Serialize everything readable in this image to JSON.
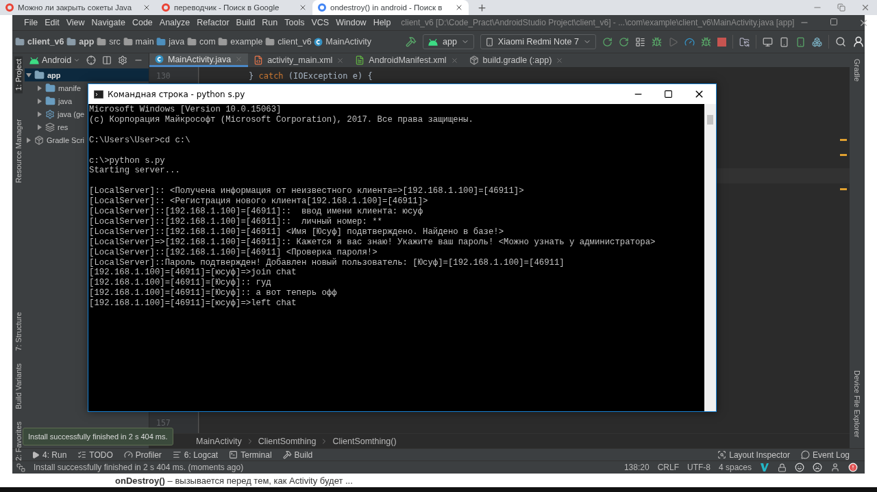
{
  "browser": {
    "tabs": [
      {
        "title": "Можно ли закрыть сокеты Java",
        "selected": false
      },
      {
        "title": "переводчик - Поиск в Google",
        "selected": false
      },
      {
        "title": "ondestroy() in android - Поиск в",
        "selected": true
      }
    ]
  },
  "ide": {
    "menu": [
      "File",
      "Edit",
      "View",
      "Navigate",
      "Code",
      "Analyze",
      "Refactor",
      "Build",
      "Run",
      "Tools",
      "VCS",
      "Window",
      "Help"
    ],
    "title": "client_v6 [D:\\Code_Pract\\AndroidStudio Project\\client_v6] - ...\\com\\example\\client_v6\\MainActivity.java [app]",
    "path": [
      {
        "label": "client_v6",
        "kind": "project"
      },
      {
        "label": "app",
        "kind": "module"
      },
      {
        "label": "src",
        "kind": "folder"
      },
      {
        "label": "main",
        "kind": "folder"
      },
      {
        "label": "java",
        "kind": "source"
      },
      {
        "label": "com",
        "kind": "package"
      },
      {
        "label": "example",
        "kind": "package"
      },
      {
        "label": "client_v6",
        "kind": "package"
      },
      {
        "label": "MainActivity",
        "kind": "class"
      }
    ],
    "run_config": "app",
    "device": "Xiaomi Redmi Note 7",
    "project_view": "Android",
    "left_tools": [
      {
        "label": "1: Project",
        "selected": true
      },
      {
        "label": "Resource Manager",
        "selected": false
      },
      {
        "label": "7: Structure",
        "selected": false
      },
      {
        "label": "Build Variants",
        "selected": false
      },
      {
        "label": "2: Favorites",
        "selected": false
      }
    ],
    "editor_tabs": [
      {
        "label": "MainActivity.java",
        "selected": true,
        "kind": "java"
      },
      {
        "label": "activity_main.xml",
        "selected": false,
        "kind": "xml"
      },
      {
        "label": "AndroidManifest.xml",
        "selected": false,
        "kind": "manifest"
      },
      {
        "label": "build.gradle (:app)",
        "selected": false,
        "kind": "gradle"
      }
    ],
    "tree": [
      {
        "label": "app",
        "expanded": true,
        "selected": true,
        "kind": "module",
        "children": [
          {
            "label": "manife",
            "expanded": false,
            "selected": false,
            "kind": "folder"
          },
          {
            "label": "java",
            "expanded": false,
            "selected": false,
            "kind": "folder"
          },
          {
            "label": "java (ge",
            "expanded": false,
            "selected": false,
            "kind": "generated"
          },
          {
            "label": "res",
            "expanded": false,
            "selected": false,
            "kind": "resources"
          }
        ]
      },
      {
        "label": "Gradle Scri",
        "expanded": false,
        "selected": false,
        "kind": "gradle"
      }
    ],
    "editor": {
      "first_line": {
        "number": "130",
        "tokens": [
          {
            "text": "} ",
            "kind": "plain"
          },
          {
            "text": "catch",
            "kind": "keyword"
          },
          {
            "text": " (IOException e) {",
            "kind": "plain"
          }
        ]
      },
      "last_line": {
        "number": "157"
      }
    },
    "right_tools": [
      "Gradle",
      "Device File Explorer"
    ],
    "nav_path": [
      "MainActivity",
      "ClientSomthing",
      "ClientSomthing()"
    ],
    "tool_windows": [
      {
        "label": "4: Run",
        "kind": "run"
      },
      {
        "label": "TODO",
        "kind": "todo"
      },
      {
        "label": "Profiler",
        "kind": "profiler"
      },
      {
        "label": "6: Logcat",
        "kind": "logcat"
      },
      {
        "label": "Terminal",
        "kind": "terminal"
      },
      {
        "label": "Build",
        "kind": "build"
      }
    ],
    "right_tool_windows": [
      {
        "label": "Layout Inspector",
        "kind": "inspector"
      },
      {
        "label": "Event Log",
        "kind": "log"
      }
    ],
    "status": {
      "message": "Install successfully finished in 2 s 404 ms. (moments ago)",
      "items": [
        "138:20",
        "CRLF",
        "UTF-8",
        "4 spaces"
      ]
    },
    "notification": "Install successfully finished in 2 s 404 ms."
  },
  "console": {
    "title": "Командная строка - python  s.py",
    "blocks": [
      [
        "Microsoft Windows [Version 10.0.15063]",
        "(c) Корпорация Майкрософт (Microsoft Corporation), 2017. Все права защищены."
      ],
      [
        "C:\\Users\\User>cd c:\\"
      ],
      [
        "c:\\>python s.py",
        "Starting server..."
      ],
      [
        "[LocalServer]:: <Получена информация от неизвестного клиента=>[192.168.1.100]=[46911]>",
        "[LocalServer]:: <Регистрация нового клиента[192.168.1.100]=[46911]>",
        "[LocalServer]::[192.168.1.100]=[46911]::  ввод имени клиента: юсуф",
        "[LocalServer]::[192.168.1.100]=[46911]::  личный номер: **",
        "[LocalServer]::[192.168.1.100]=[46911] <Имя [Юсуф] подвтверждено. Найдено в базе!>",
        "[LocalServer]=>[192.168.1.100]=[46911]:: Кажется я вас знаю! Укажите ваш пароль! <Можно узнать у администратора>",
        "[LocalServer]::[192.168.1.100]=[46911] <Проверка пароля!>",
        "[LocalServer]::Пароль подтвержден! Добавлен новый пользователь: [Юсуф]=[192.168.1.100]=[46911]",
        "[192.168.1.100]=[46911]=[юсуф]=>join chat",
        "[192.168.1.100]=[46911]=[Юсуф]:: гуд",
        "[192.168.1.100]=[46911]=[Юсуф]:: а вот теперь офф",
        "[192.168.1.100]=[46911]=[юсуф]=>left chat"
      ]
    ]
  },
  "caption": "**onDestroy()** – вызывается перед тем, как Activity будет ..."
}
